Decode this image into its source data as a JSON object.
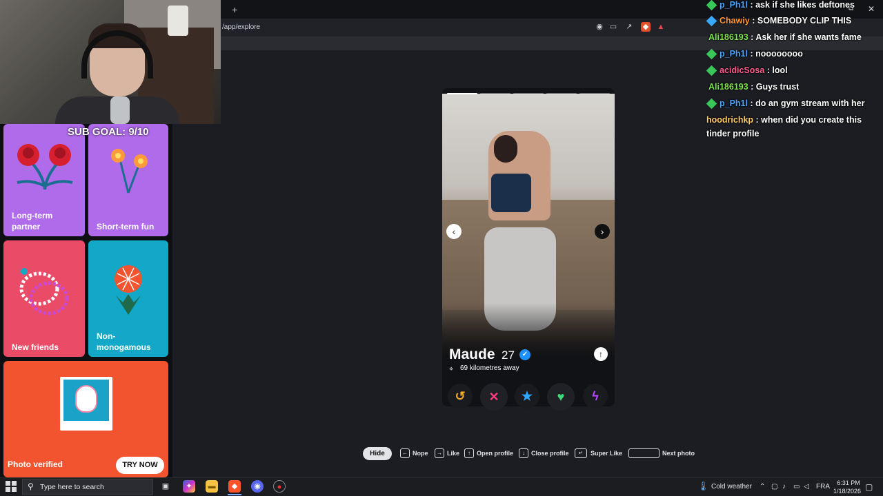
{
  "browser": {
    "new_tab_symbol": "+",
    "url": "/app/explore",
    "close_symbol": "✕",
    "restore_symbol": "⧉"
  },
  "overlay": {
    "sub_goal": "SUB GOAL: 9/10"
  },
  "explore_cards": {
    "long_term": "Long-term partner",
    "short_term": "Short-term fun",
    "new_friends": "New friends",
    "non_monogamous": "Non-monogamous",
    "photo_verified": "Photo verified",
    "try_now": "TRY NOW"
  },
  "profile": {
    "name": "Maude",
    "age": "27",
    "distance": "69 kilometres away",
    "verified_symbol": "✓",
    "photo_count": 5,
    "current_photo": 1
  },
  "actions": {
    "rewind": "↺",
    "nope": "✕",
    "super_like": "★",
    "like": "♥",
    "boost": "ϟ"
  },
  "shortcuts": {
    "hide": "Hide",
    "nope": "Nope",
    "like": "Like",
    "open_profile": "Open profile",
    "close_profile": "Close profile",
    "super_like": "Super Like",
    "next_photo": "Next photo"
  },
  "chat": [
    {
      "user": "p_Ph1l",
      "color": "#4aa3ff",
      "badge": "green",
      "message": "ask if she likes deftones"
    },
    {
      "user": "Chawiy",
      "color": "#ff9a3c",
      "badge": "blue",
      "message": "SOMEBODY CLIP THIS"
    },
    {
      "user": "Ali186193",
      "color": "#7ee04a",
      "badge": "",
      "message": "Ask her if she wants fame"
    },
    {
      "user": "p_Ph1l",
      "color": "#4aa3ff",
      "badge": "green",
      "message": "noooooooo"
    },
    {
      "user": "acidicSosa",
      "color": "#ff5c8d",
      "badge": "green",
      "message": "lool"
    },
    {
      "user": "Ali186193",
      "color": "#7ee04a",
      "badge": "",
      "message": "Guys trust"
    },
    {
      "user": "p_Ph1l",
      "color": "#4aa3ff",
      "badge": "green",
      "message": "do an gym stream with her"
    },
    {
      "user": "hoodrichkp",
      "color": "#ffcf6b",
      "badge": "",
      "message": "when did you create this tinder profile"
    }
  ],
  "taskbar": {
    "search_placeholder": "Type here to search",
    "weather": "Cold weather",
    "language": "FRA",
    "time": "6:31 PM",
    "date": "1/18/2026"
  }
}
